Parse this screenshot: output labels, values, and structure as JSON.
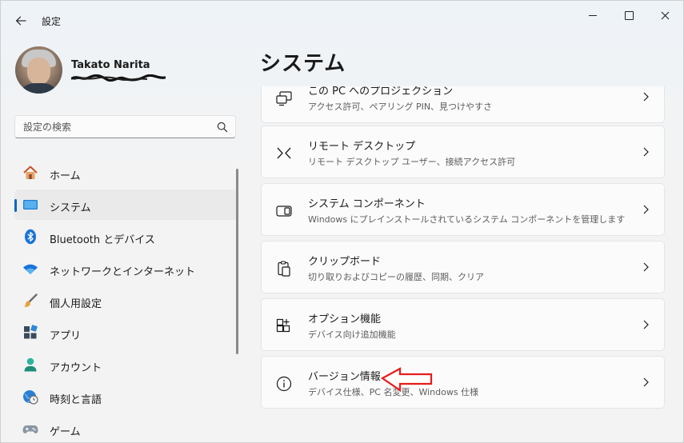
{
  "window": {
    "title": "設定",
    "back_icon": "arrow-left-icon",
    "controls": [
      "minimize",
      "maximize",
      "close"
    ]
  },
  "user": {
    "name": "Takato Narita"
  },
  "search": {
    "placeholder": "設定の検索",
    "icon": "search-icon"
  },
  "sidebar": {
    "items": [
      {
        "label": "ホーム",
        "icon": "home-icon",
        "active": false
      },
      {
        "label": "システム",
        "icon": "system-display-icon",
        "active": true
      },
      {
        "label": "Bluetooth とデバイス",
        "icon": "bluetooth-icon",
        "active": false
      },
      {
        "label": "ネットワークとインターネット",
        "icon": "wifi-icon",
        "active": false
      },
      {
        "label": "個人用設定",
        "icon": "brush-icon",
        "active": false
      },
      {
        "label": "アプリ",
        "icon": "apps-icon",
        "active": false
      },
      {
        "label": "アカウント",
        "icon": "account-icon",
        "active": false
      },
      {
        "label": "時刻と言語",
        "icon": "globe-clock-icon",
        "active": false
      },
      {
        "label": "ゲーム",
        "icon": "gamepad-icon",
        "active": false
      }
    ]
  },
  "main": {
    "title": "システム",
    "cards": [
      {
        "title": "この PC へのプロジェクション",
        "subtitle": "アクセス許可、ペアリング PIN、見つけやすさ",
        "icon": "projection-icon"
      },
      {
        "title": "リモート デスクトップ",
        "subtitle": "リモート デスクトップ ユーザー、接続アクセス許可",
        "icon": "remote-desktop-icon"
      },
      {
        "title": "システム コンポーネント",
        "subtitle": "Windows にプレインストールされているシステム コンポーネントを管理します",
        "icon": "system-components-icon"
      },
      {
        "title": "クリップボード",
        "subtitle": "切り取りおよびコピーの履歴、同期、クリア",
        "icon": "clipboard-icon"
      },
      {
        "title": "オプション機能",
        "subtitle": "デバイス向け追加機能",
        "icon": "optional-features-icon"
      },
      {
        "title": "バージョン情報",
        "subtitle": "デバイス仕様、PC 名変更、Windows 仕様",
        "icon": "info-icon"
      }
    ]
  },
  "annotation": {
    "arrow_color": "#e81c1c",
    "points_to": "バージョン情報"
  },
  "colors": {
    "accent": "#0067c0",
    "background": "#f3f3f3",
    "card": "#fbfbfb"
  }
}
